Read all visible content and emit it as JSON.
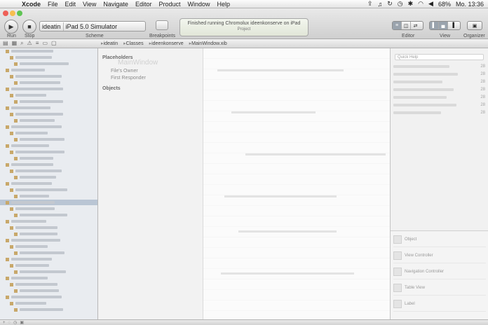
{
  "menubar": {
    "app": "Xcode",
    "items": [
      "File",
      "Edit",
      "View",
      "Navigate",
      "Editor",
      "Product",
      "Window",
      "Help"
    ],
    "battery": "68%",
    "clock": "Mo. 13:36"
  },
  "toolbar": {
    "run_label": "Run",
    "stop_label": "Stop",
    "scheme_label": "Scheme",
    "scheme_target": "ideatin",
    "scheme_destination": "iPad 5.0 Simulator",
    "breakpoints_label": "Breakpoints",
    "activity_text": "Finished running Chromolux ideenkonserve on iPad",
    "activity_sub": "Project",
    "editor_label": "Editor",
    "view_label": "View",
    "organizer_label": "Organizer"
  },
  "jumpbar": {
    "crumbs": [
      "ideatin",
      "Classes",
      "ideenkonserve",
      "MainWindow.xib"
    ]
  },
  "outline": {
    "placeholders_header": "Placeholders",
    "files_owner": "File's Owner",
    "first_responder": "First Responder",
    "objects_header": "Objects",
    "ghost_title": "MainWindow"
  },
  "utilities": {
    "search_placeholder": "Quick Help",
    "numbers": [
      "28",
      "28",
      "28",
      "28",
      "28",
      "28",
      "28"
    ],
    "library_items": [
      "Object",
      "View Controller",
      "Navigation Controller",
      "Table View",
      "Label"
    ]
  }
}
